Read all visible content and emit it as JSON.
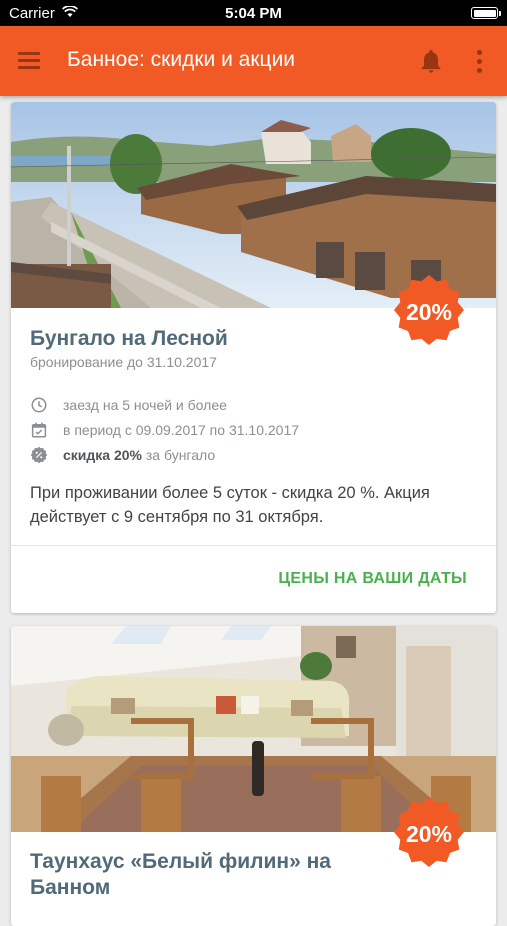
{
  "status_bar": {
    "carrier": "Carrier",
    "time": "5:04 PM"
  },
  "app_bar": {
    "title": "Банное: скидки и акции",
    "icons": [
      "menu-icon",
      "bell-icon",
      "more-vert-icon"
    ]
  },
  "colors": {
    "accent": "#f15a24",
    "title": "#516a7a",
    "cta": "#4caf50"
  },
  "offers": [
    {
      "discount_badge": "20%",
      "title": "Бунгало на Лесной",
      "booking": "бронирование до 31.10.2017",
      "conditions": [
        {
          "icon": "clock-icon",
          "text": "заезд на 5 ночей и более"
        },
        {
          "icon": "calendar-check-icon",
          "text": "в период с 09.09.2017 по 31.10.2017"
        },
        {
          "icon": "discount-badge-icon",
          "bold": "скидка 20%",
          "text": " за бунгало"
        }
      ],
      "description": "При проживании более 5 суток - скидка 20 %. Акция действует с 9 сентября по 31 октября.",
      "cta": "ЦЕНЫ НА ВАШИ ДАТЫ"
    },
    {
      "discount_badge": "20%",
      "title": "Таунхаус «Белый филин» на Банном"
    }
  ]
}
